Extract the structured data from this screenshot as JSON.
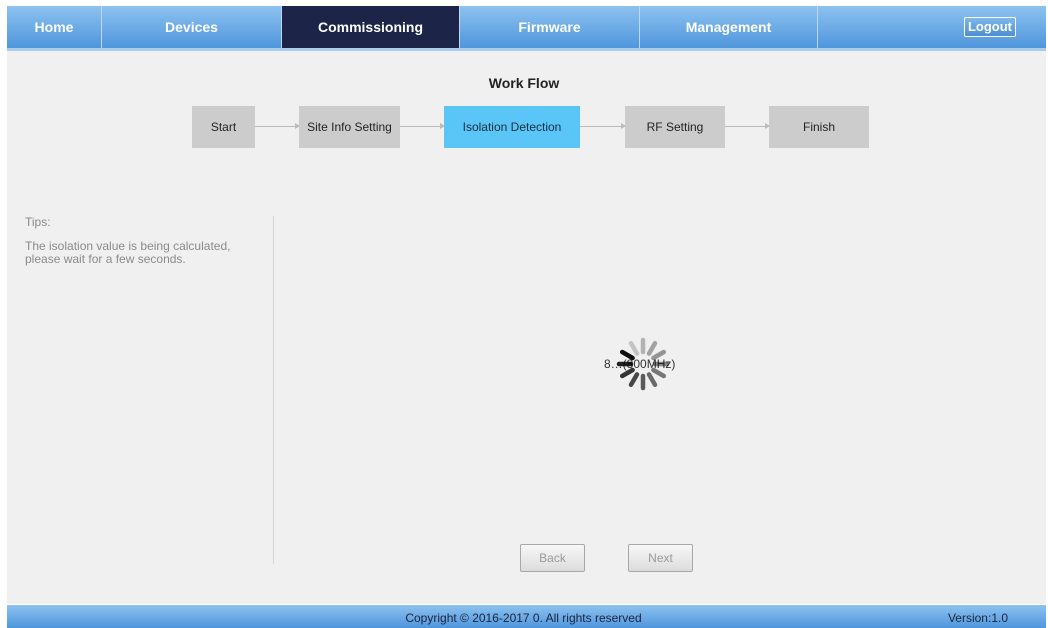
{
  "nav": {
    "items": [
      {
        "label": "Home"
      },
      {
        "label": "Devices"
      },
      {
        "label": "Commissioning"
      },
      {
        "label": "Firmware"
      },
      {
        "label": "Management"
      }
    ],
    "active_index": 2,
    "logout_label": "Logout"
  },
  "workflow": {
    "title": "Work Flow",
    "steps": [
      {
        "label": "Start"
      },
      {
        "label": "Site Info Setting"
      },
      {
        "label": "Isolation Detection"
      },
      {
        "label": "RF Setting"
      },
      {
        "label": "Finish"
      }
    ],
    "active_index": 2
  },
  "tips": {
    "title": "Tips:",
    "text": "The isolation value is being calculated, please wait for a few seconds."
  },
  "progress": {
    "text": "8…(800MHz)"
  },
  "buttons": {
    "back": "Back",
    "next": "Next"
  },
  "footer": {
    "copyright": "Copyright © 2016-2017 0. All rights reserved",
    "version": "Version:1.0"
  },
  "colors": {
    "nav_active": "#1c2447",
    "step_active": "#5ac6f7",
    "step_default": "#cccccc"
  },
  "icons": {
    "spinner": "loading-spinner-icon"
  }
}
